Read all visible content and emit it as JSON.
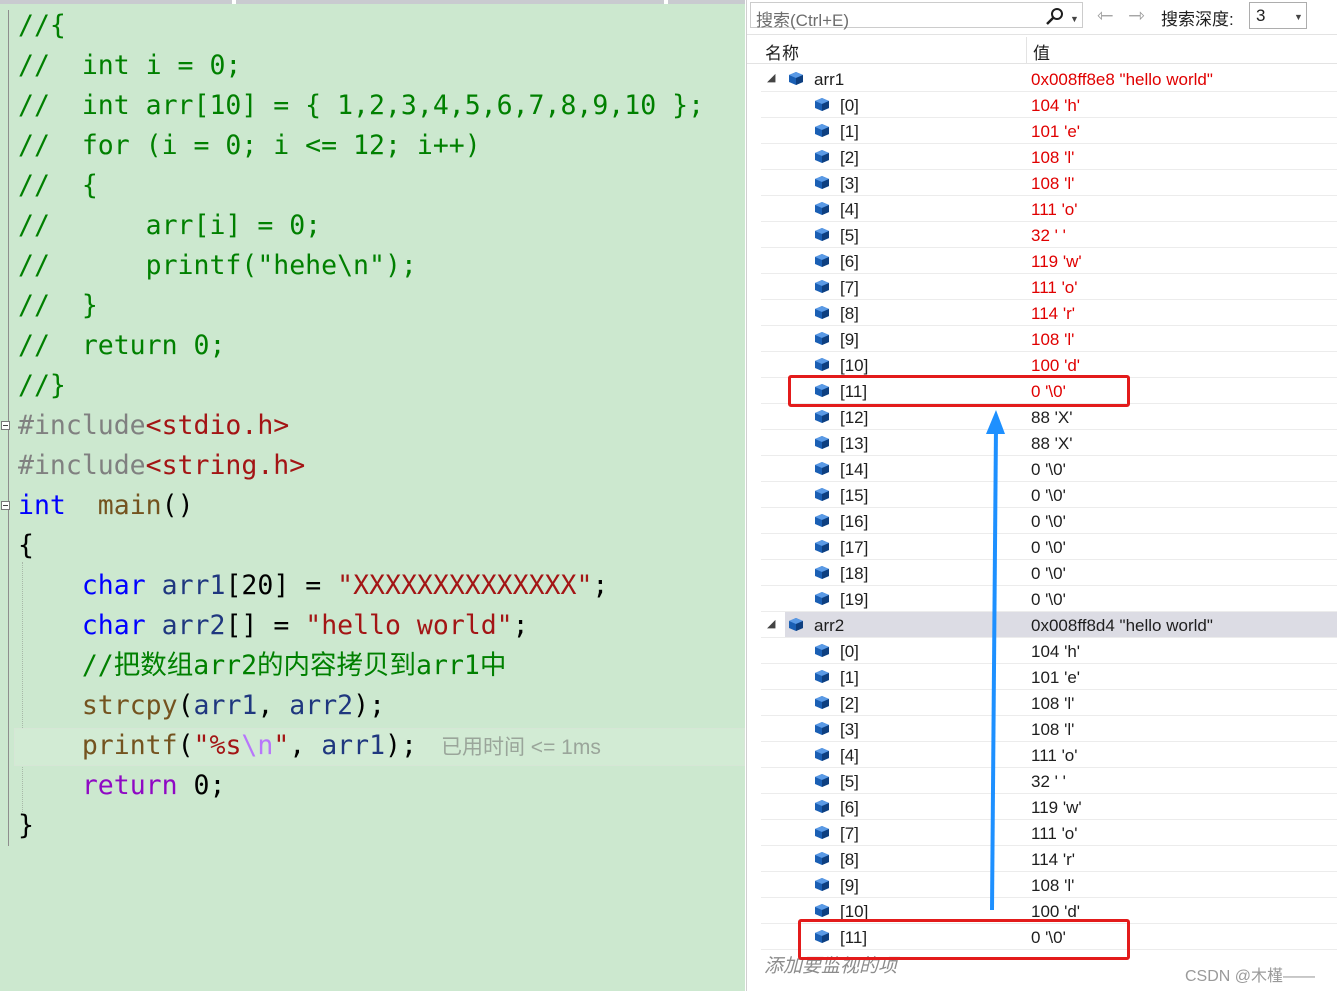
{
  "editor": {
    "lines": [
      [
        [
          "c-cm",
          "//{"
        ]
      ],
      [
        [
          "c-cm",
          "//  int i = 0;"
        ]
      ],
      [
        [
          "c-cm",
          "//  int arr[10] = { 1,2,3,4,5,6,7,8,9,10 };"
        ]
      ],
      [
        [
          "c-cm",
          "//  for (i = 0; i <= 12; i++)"
        ]
      ],
      [
        [
          "c-cm",
          "//  {"
        ]
      ],
      [
        [
          "c-cm",
          "//      arr[i] = 0;"
        ]
      ],
      [
        [
          "c-cm",
          "//      printf(\"hehe\\n\");"
        ]
      ],
      [
        [
          "c-cm",
          "//  }"
        ]
      ],
      [
        [
          "c-cm",
          "//  return 0;"
        ]
      ],
      [
        [
          "c-cm",
          "//}"
        ]
      ],
      [
        [
          "c-pp",
          "#include"
        ],
        [
          "c-str",
          "<stdio.h>"
        ]
      ],
      [
        [
          "c-pp",
          "#include"
        ],
        [
          "c-str",
          "<string.h>"
        ]
      ],
      [
        [
          "c-kw",
          "int"
        ],
        [
          "",
          "  "
        ],
        [
          "c-fn",
          "main"
        ],
        [
          "",
          "()"
        ]
      ],
      [
        [
          "",
          "{"
        ]
      ],
      [
        [
          "",
          "    "
        ],
        [
          "c-kw",
          "char"
        ],
        [
          "",
          " "
        ],
        [
          "c-var",
          "arr1"
        ],
        [
          "",
          "[20] = "
        ],
        [
          "c-str",
          "\"XXXXXXXXXXXXXX\""
        ],
        [
          "",
          ";"
        ]
      ],
      [
        [
          "",
          "    "
        ],
        [
          "c-kw",
          "char"
        ],
        [
          "",
          " "
        ],
        [
          "c-var",
          "arr2"
        ],
        [
          "",
          "[] = "
        ],
        [
          "c-str",
          "\"hello world\""
        ],
        [
          "",
          ";"
        ]
      ],
      [
        [
          "",
          "    "
        ],
        [
          "c-cm",
          "//把数组arr2的内容拷贝到arr1中"
        ]
      ],
      [
        [
          "",
          "    "
        ],
        [
          "c-fn",
          "strcpy"
        ],
        [
          "",
          "("
        ],
        [
          "c-var",
          "arr1"
        ],
        [
          "",
          ", "
        ],
        [
          "c-var",
          "arr2"
        ],
        [
          "",
          ");"
        ]
      ],
      [
        [
          "",
          "    "
        ],
        [
          "c-fn",
          "printf"
        ],
        [
          "",
          "("
        ],
        [
          "c-str",
          "\"%s"
        ],
        [
          "c-esc",
          "\\n"
        ],
        [
          "c-str",
          "\""
        ],
        [
          "",
          ", "
        ],
        [
          "c-var",
          "arr1"
        ],
        [
          "",
          ");"
        ]
      ],
      [
        [
          "",
          "    "
        ],
        [
          "c-ret",
          "return"
        ],
        [
          "",
          " 0;"
        ]
      ],
      [
        [
          "",
          "}"
        ]
      ]
    ],
    "elapsed_hint": "已用时间 <= 1ms"
  },
  "watch": {
    "search_placeholder": "搜索(Ctrl+E)",
    "depth_label": "搜索深度:",
    "depth_value": "3",
    "column_name": "名称",
    "column_value": "值",
    "add_watch": "添加要监视的项",
    "rows": [
      {
        "level": 0,
        "name": "arr1",
        "value": "0x008ff8e8 \"hello world\"",
        "changed": true
      },
      {
        "level": 1,
        "name": "[0]",
        "value": "104 'h'",
        "changed": true
      },
      {
        "level": 1,
        "name": "[1]",
        "value": "101 'e'",
        "changed": true
      },
      {
        "level": 1,
        "name": "[2]",
        "value": "108 'l'",
        "changed": true
      },
      {
        "level": 1,
        "name": "[3]",
        "value": "108 'l'",
        "changed": true
      },
      {
        "level": 1,
        "name": "[4]",
        "value": "111 'o'",
        "changed": true
      },
      {
        "level": 1,
        "name": "[5]",
        "value": "32 ' '",
        "changed": true
      },
      {
        "level": 1,
        "name": "[6]",
        "value": "119 'w'",
        "changed": true
      },
      {
        "level": 1,
        "name": "[7]",
        "value": "111 'o'",
        "changed": true
      },
      {
        "level": 1,
        "name": "[8]",
        "value": "114 'r'",
        "changed": true
      },
      {
        "level": 1,
        "name": "[9]",
        "value": "108 'l'",
        "changed": true
      },
      {
        "level": 1,
        "name": "[10]",
        "value": "100 'd'",
        "changed": true
      },
      {
        "level": 1,
        "name": "[11]",
        "value": "0 '\\0'",
        "changed": true
      },
      {
        "level": 1,
        "name": "[12]",
        "value": "88 'X'",
        "changed": false
      },
      {
        "level": 1,
        "name": "[13]",
        "value": "88 'X'",
        "changed": false
      },
      {
        "level": 1,
        "name": "[14]",
        "value": "0 '\\0'",
        "changed": false
      },
      {
        "level": 1,
        "name": "[15]",
        "value": "0 '\\0'",
        "changed": false
      },
      {
        "level": 1,
        "name": "[16]",
        "value": "0 '\\0'",
        "changed": false
      },
      {
        "level": 1,
        "name": "[17]",
        "value": "0 '\\0'",
        "changed": false
      },
      {
        "level": 1,
        "name": "[18]",
        "value": "0 '\\0'",
        "changed": false
      },
      {
        "level": 1,
        "name": "[19]",
        "value": "0 '\\0'",
        "changed": false
      },
      {
        "level": 0,
        "name": "arr2",
        "value": "0x008ff8d4 \"hello world\"",
        "changed": false,
        "selected": true
      },
      {
        "level": 1,
        "name": "[0]",
        "value": "104 'h'",
        "changed": false
      },
      {
        "level": 1,
        "name": "[1]",
        "value": "101 'e'",
        "changed": false
      },
      {
        "level": 1,
        "name": "[2]",
        "value": "108 'l'",
        "changed": false
      },
      {
        "level": 1,
        "name": "[3]",
        "value": "108 'l'",
        "changed": false
      },
      {
        "level": 1,
        "name": "[4]",
        "value": "111 'o'",
        "changed": false
      },
      {
        "level": 1,
        "name": "[5]",
        "value": "32 ' '",
        "changed": false
      },
      {
        "level": 1,
        "name": "[6]",
        "value": "119 'w'",
        "changed": false
      },
      {
        "level": 1,
        "name": "[7]",
        "value": "111 'o'",
        "changed": false
      },
      {
        "level": 1,
        "name": "[8]",
        "value": "114 'r'",
        "changed": false
      },
      {
        "level": 1,
        "name": "[9]",
        "value": "108 'l'",
        "changed": false
      },
      {
        "level": 1,
        "name": "[10]",
        "value": "100 'd'",
        "changed": false
      },
      {
        "level": 1,
        "name": "[11]",
        "value": "0 '\\0'",
        "changed": false
      }
    ]
  },
  "watermark": "CSDN @木槿——",
  "colors": {
    "changed_value": "#e00000",
    "normal_value": "#1e1e1e",
    "highlight_box": "#e31b1b",
    "annotation_arrow": "#1e90ff",
    "editor_background": "#cce8cf"
  }
}
